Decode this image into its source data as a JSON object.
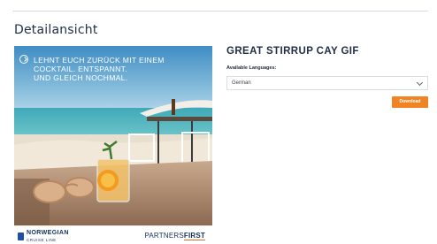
{
  "page": {
    "title": "Detailansicht"
  },
  "preview": {
    "promo_lines": [
      "LEHNT EUCH ZURÜCK MIT EINEM",
      "COCKTAIL. ENTSPANNT.",
      "UND GLEICH NOCHMAL."
    ],
    "brand_left": "NORWEGIAN",
    "brand_left_sub": "CRUISE LINE",
    "brand_right_light": "PARTNERS",
    "brand_right_bold": "FIRST"
  },
  "detail": {
    "title": "GREAT STIRRUP CAY GIF",
    "languages_label": "Available Languages:",
    "language_selected": "German",
    "download_label": "Download"
  },
  "colors": {
    "accent": "#f08424",
    "brand_blue": "#12305f"
  },
  "icons": [
    "replay-circle-icon",
    "chevron-down-icon",
    "ncl-logo",
    "partners-first-logo"
  ]
}
